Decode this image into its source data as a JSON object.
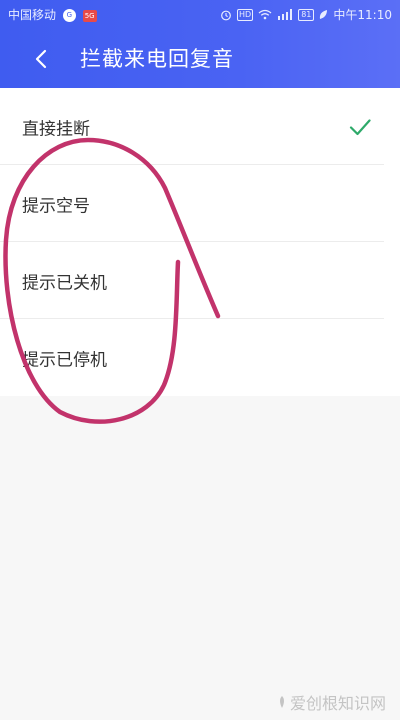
{
  "status_bar": {
    "carrier": "中国移动",
    "badge1": "G",
    "badge2": "5G",
    "alarm_icon": "alarm-icon",
    "hd_label": "HD",
    "wifi_icon": "wifi-icon",
    "signal_icon": "signal-icon",
    "battery_level": "81",
    "leaf_icon": "leaf-icon",
    "time": "中午11:10"
  },
  "header": {
    "back_icon": "back-chevron-icon",
    "title": "拦截来电回复音",
    "bg_color": "#4660f2"
  },
  "list": {
    "items": [
      {
        "label": "直接挂断",
        "selected": true
      },
      {
        "label": "提示空号",
        "selected": false
      },
      {
        "label": "提示已关机",
        "selected": false
      },
      {
        "label": "提示已停机",
        "selected": false
      }
    ],
    "check_color": "#2eaa6a"
  },
  "annotation": {
    "stroke_color": "#c2336b"
  },
  "watermark": {
    "text": "爱创根知识网"
  }
}
